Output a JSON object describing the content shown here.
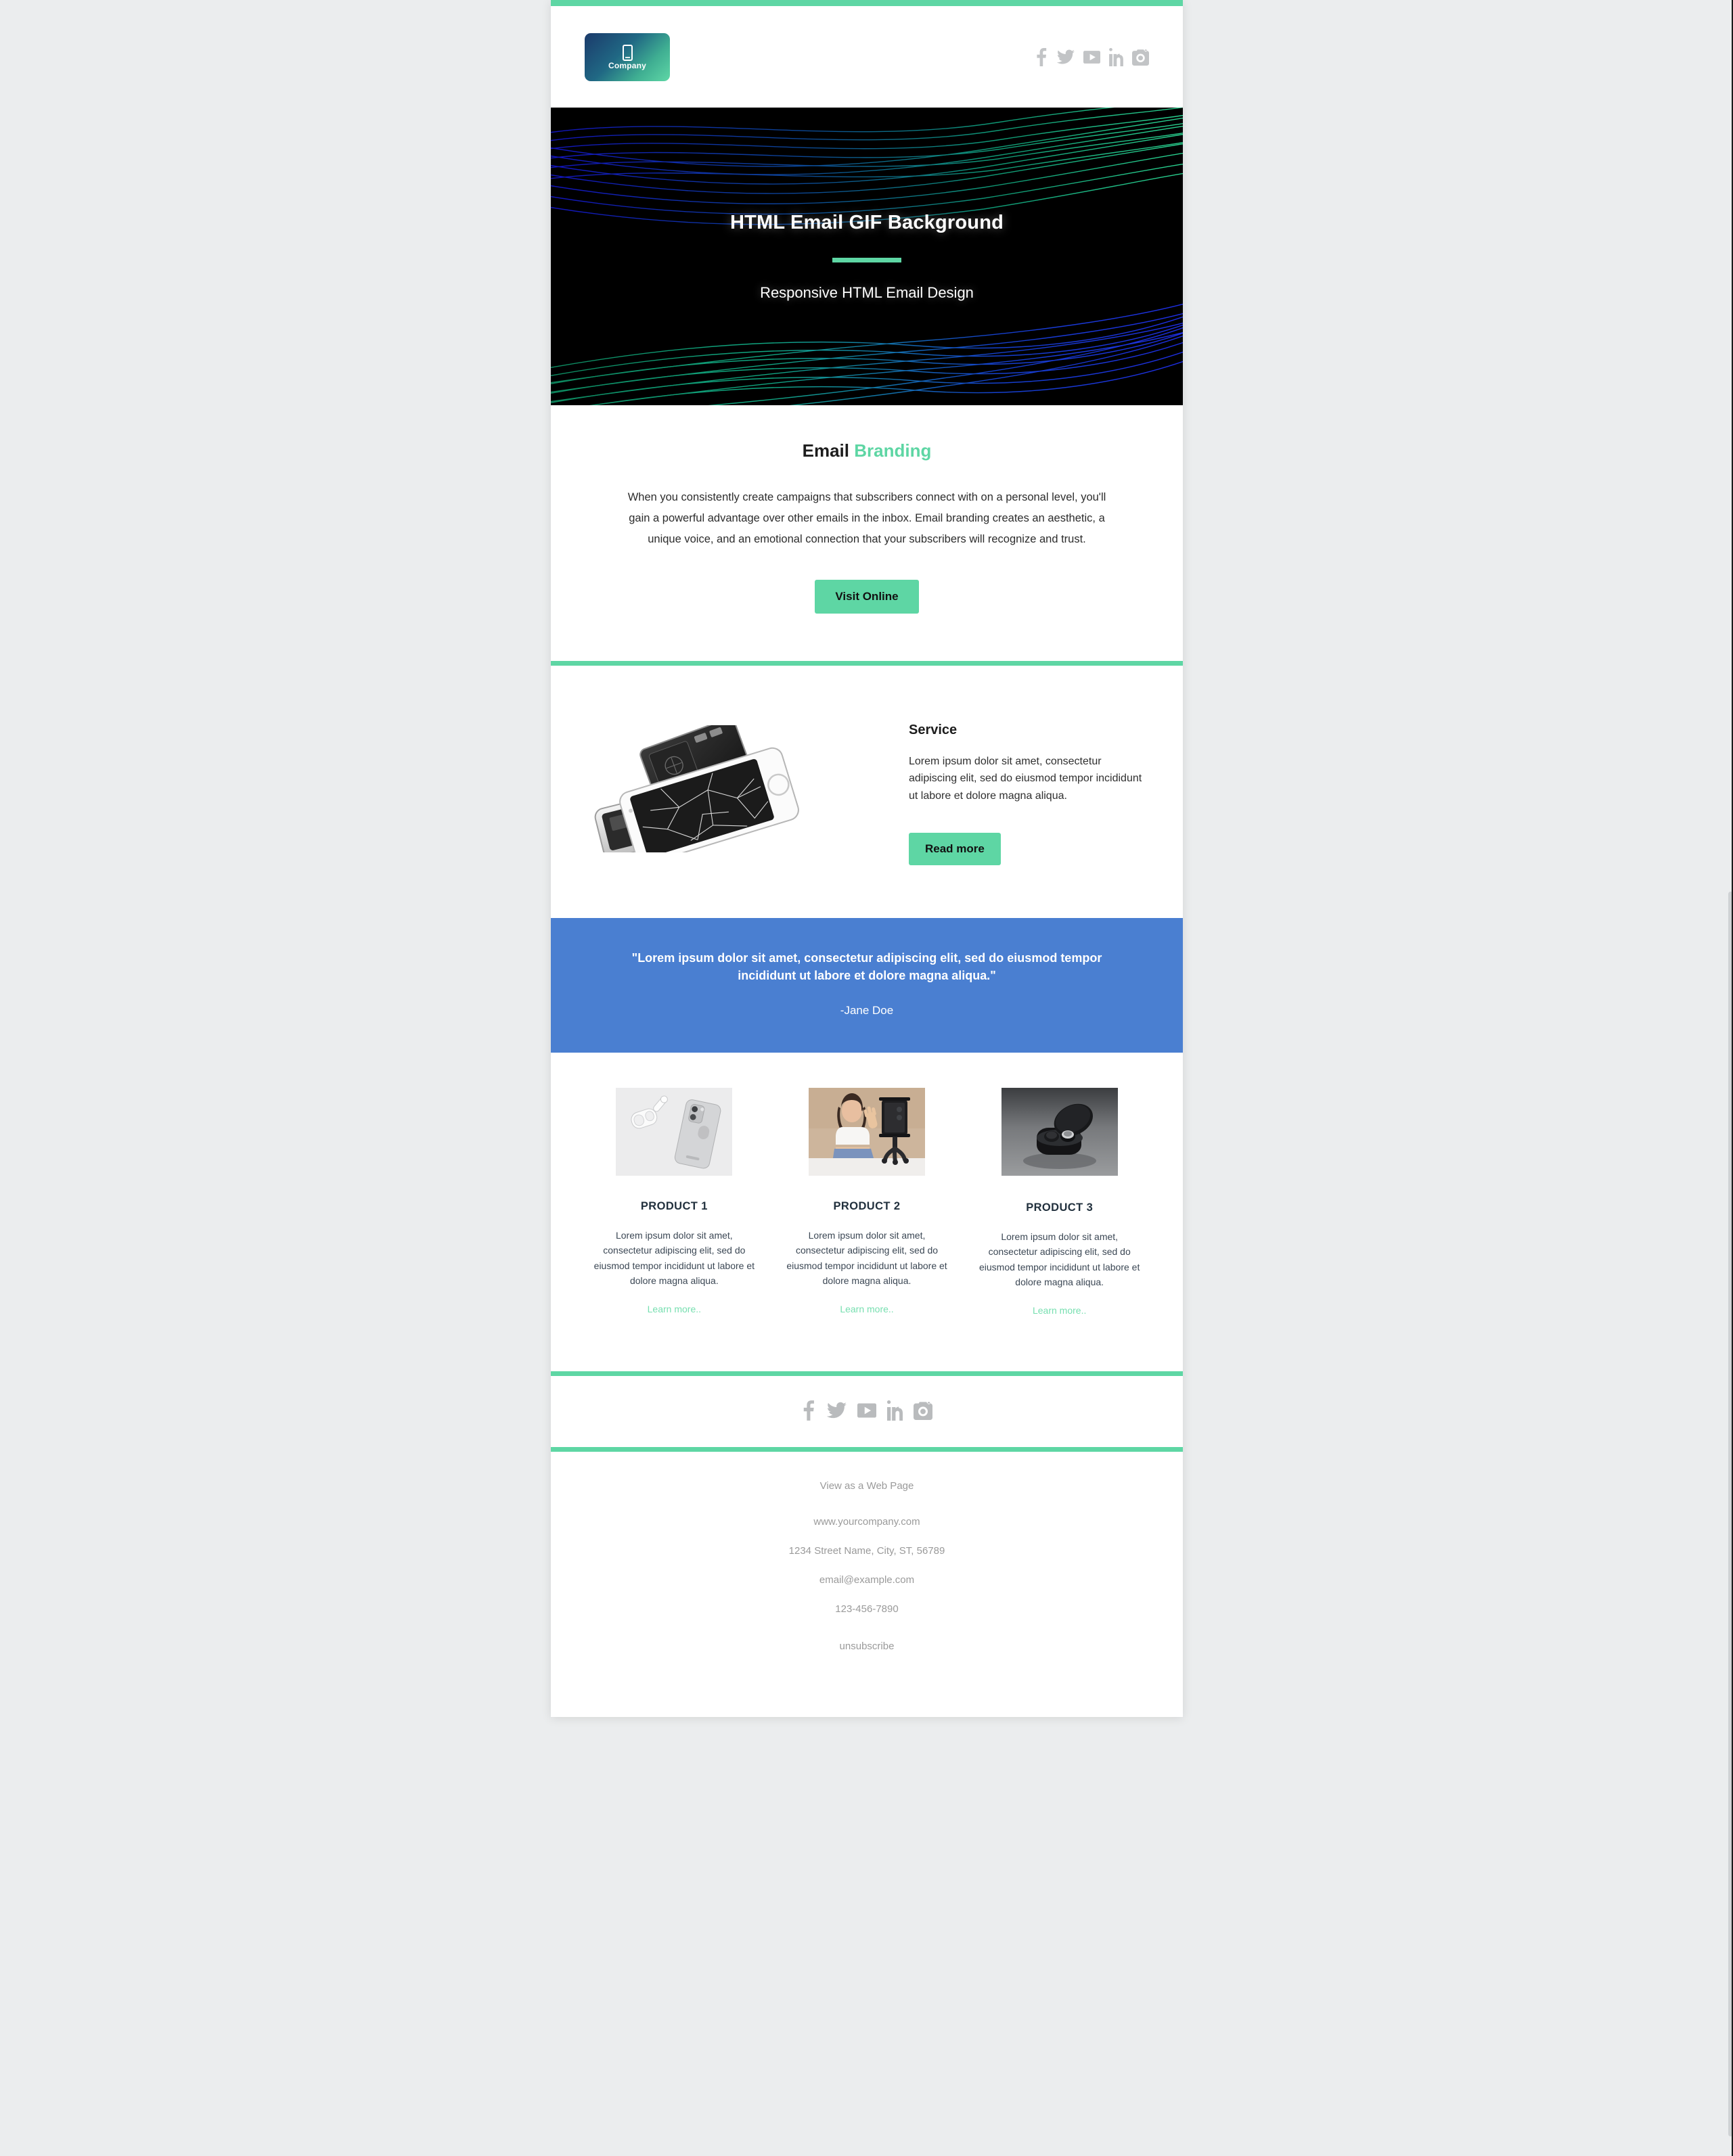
{
  "colors": {
    "accent_green": "#5ed6a4",
    "link_green": "#77dfb0",
    "testimonial_blue": "#4a7fd1",
    "page_background": "#ebedee",
    "hero_background": "#000000",
    "social_icon_gray": "#c2c4c6"
  },
  "header": {
    "logo": {
      "icon": "mobile-phone-icon",
      "label": "Company"
    },
    "social": [
      {
        "name": "facebook-icon",
        "label": "Facebook"
      },
      {
        "name": "twitter-icon",
        "label": "Twitter"
      },
      {
        "name": "youtube-icon",
        "label": "YouTube"
      },
      {
        "name": "linkedin-icon",
        "label": "LinkedIn"
      },
      {
        "name": "instagram-icon",
        "label": "Instagram"
      }
    ]
  },
  "hero": {
    "title": "HTML Email GIF Background",
    "subtitle": "Responsive HTML Email Design"
  },
  "branding": {
    "title_plain": "Email",
    "title_accent": "Branding",
    "body": "When you consistently create campaigns that subscribers connect with on a personal level, you'll gain a powerful advantage over other emails in the inbox. Email branding creates an aesthetic, a unique voice, and an emotional connection that your subscribers will recognize and trust.",
    "cta_label": "Visit Online"
  },
  "service": {
    "image_alt": "broken-smartphone-photo",
    "title": "Service",
    "body": "Lorem ipsum dolor sit amet, consectetur adipiscing elit, sed do eiusmod tempor incididunt ut labore et dolore magna aliqua.",
    "cta_label": "Read more"
  },
  "testimonial": {
    "quote": "\"Lorem ipsum dolor sit amet, consectetur adipiscing elit, sed do eiusmod tempor incididunt ut labore et dolore magna aliqua.\"",
    "author": "-Jane Doe"
  },
  "products": [
    {
      "image_alt": "iphone-and-airpods-photo",
      "title": "PRODUCT 1",
      "body": "Lorem ipsum dolor sit amet, consectetur adipiscing elit, sed do eiusmod tempor incididunt ut labore et dolore magna aliqua.",
      "link_label": "Learn more.."
    },
    {
      "image_alt": "woman-filming-with-phone-tripod-photo",
      "title": "PRODUCT 2",
      "body": "Lorem ipsum dolor sit amet, consectetur adipiscing elit, sed do eiusmod tempor incididunt ut labore et dolore magna aliqua.",
      "link_label": "Learn more.."
    },
    {
      "image_alt": "wireless-earbuds-case-photo",
      "title": "PRODUCT 3",
      "body": "Lorem ipsum dolor sit amet, consectetur adipiscing elit, sed do eiusmod tempor incididunt ut labore et dolore magna aliqua.",
      "link_label": "Learn more.."
    }
  ],
  "footer": {
    "social": [
      {
        "name": "facebook-icon",
        "label": "Facebook"
      },
      {
        "name": "twitter-icon",
        "label": "Twitter"
      },
      {
        "name": "youtube-icon",
        "label": "YouTube"
      },
      {
        "name": "linkedin-icon",
        "label": "LinkedIn"
      },
      {
        "name": "instagram-icon",
        "label": "Instagram"
      }
    ],
    "view_web_page": "View as a Web Page",
    "website": "www.yourcompany.com",
    "address": "1234 Street Name, City, ST, 56789",
    "email": "email@example.com",
    "phone": "123-456-7890",
    "unsubscribe": "unsubscribe"
  }
}
